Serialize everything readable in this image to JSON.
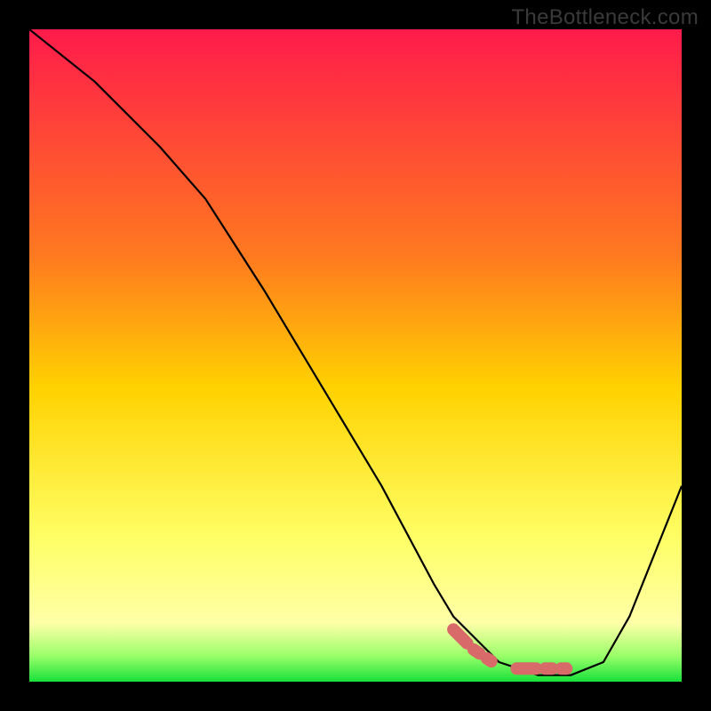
{
  "watermark": "TheBottleneck.com",
  "chart_data": {
    "type": "line",
    "title": "",
    "xlabel": "",
    "ylabel": "",
    "xlim": [
      0,
      100
    ],
    "ylim": [
      0,
      100
    ],
    "grid": false,
    "gradient_stops": [
      {
        "offset": 0,
        "color": "#ff1b4b"
      },
      {
        "offset": 35,
        "color": "#ff7a1f"
      },
      {
        "offset": 55,
        "color": "#ffd200"
      },
      {
        "offset": 78,
        "color": "#ffff66"
      },
      {
        "offset": 91,
        "color": "#ffffa8"
      },
      {
        "offset": 96,
        "color": "#9bff6a"
      },
      {
        "offset": 100,
        "color": "#18e03a"
      }
    ],
    "series": [
      {
        "name": "bottleneck-curve",
        "x": [
          0,
          10,
          20,
          27,
          36,
          45,
          54,
          62,
          65,
          72,
          78,
          83,
          88,
          92,
          100
        ],
        "y": [
          100,
          92,
          82,
          74,
          60,
          45,
          30,
          15,
          10,
          3,
          1,
          1,
          3,
          10,
          30
        ]
      }
    ],
    "highlight_segment": {
      "name": "optimal-zone-marker",
      "color": "#d86a6a",
      "x": [
        65,
        68,
        71,
        74,
        77,
        79,
        81,
        83
      ],
      "y": [
        8,
        5,
        3,
        2,
        2,
        2,
        2,
        2
      ]
    }
  }
}
